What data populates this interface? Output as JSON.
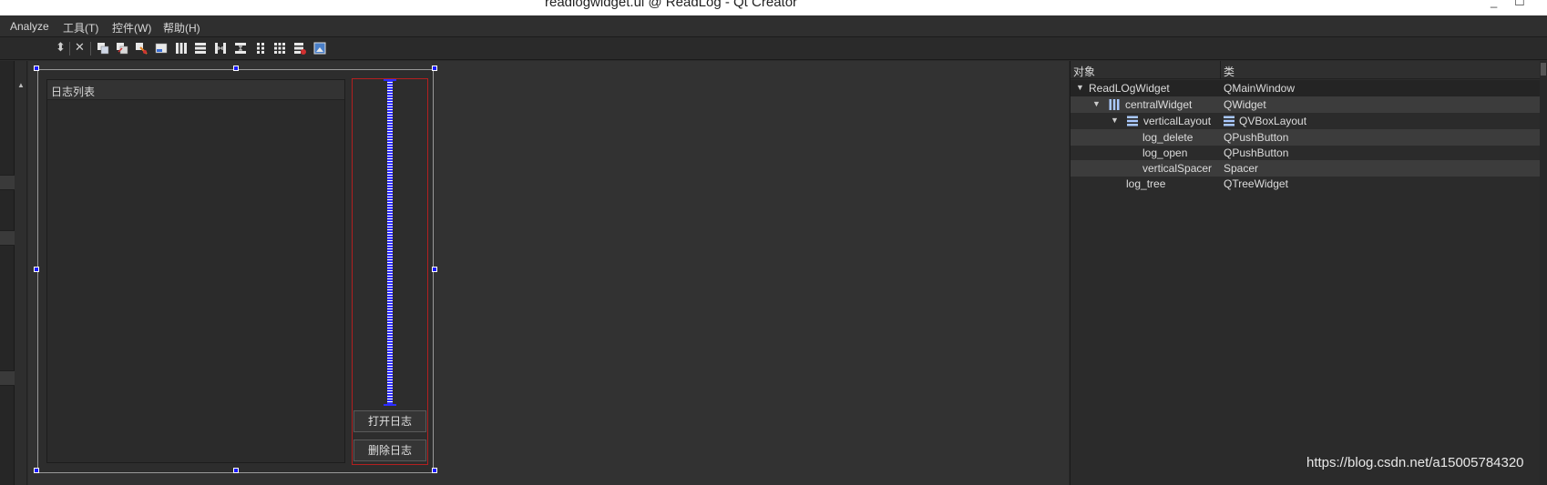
{
  "window": {
    "title": "readlogwidget.ui @ ReadLog - Qt Creator",
    "min_glyph": "_",
    "max_glyph": "☐"
  },
  "menubar": {
    "items": [
      "Analyze",
      "工具(T)",
      "控件(W)",
      "帮助(H)"
    ]
  },
  "toolbar": {
    "spinner_glyph": "⬍",
    "close_glyph": "✕",
    "icons": [
      "edit-widgets-icon",
      "edit-signals-icon",
      "edit-buddies-icon",
      "edit-tab-order-icon",
      "layout-horizontal-icon",
      "layout-vertical-icon",
      "layout-horizontal-splitter-icon",
      "layout-vertical-splitter-icon",
      "layout-form-icon",
      "layout-grid-icon",
      "break-layout-icon",
      "adjust-size-icon"
    ]
  },
  "form": {
    "tree_header": "日志列表",
    "open_button": "打开日志",
    "delete_button": "删除日志"
  },
  "object_inspector": {
    "col_object": "对象",
    "col_class": "类",
    "rows": [
      {
        "name": "ReadLOgWidget",
        "cls": "QMainWindow",
        "depth": 0,
        "expanded": true,
        "icon": ""
      },
      {
        "name": "centralWidget",
        "cls": "QWidget",
        "depth": 1,
        "expanded": true,
        "icon": "hbox-layout-icon"
      },
      {
        "name": "verticalLayout",
        "cls": "QVBoxLayout",
        "depth": 2,
        "expanded": true,
        "icon": "vbox-layout-icon"
      },
      {
        "name": "log_delete",
        "cls": "QPushButton",
        "depth": 3,
        "expanded": false,
        "icon": ""
      },
      {
        "name": "log_open",
        "cls": "QPushButton",
        "depth": 3,
        "expanded": false,
        "icon": ""
      },
      {
        "name": "verticalSpacer",
        "cls": "Spacer",
        "depth": 3,
        "expanded": false,
        "icon": ""
      },
      {
        "name": "log_tree",
        "cls": "QTreeWidget",
        "depth": 2,
        "expanded": false,
        "icon": ""
      }
    ]
  },
  "watermark": "https://blog.csdn.net/a15005784320",
  "colors": {
    "selection_handle": "#1a1aff",
    "layout_border": "#b32020",
    "spacer": "#2d2dff"
  }
}
